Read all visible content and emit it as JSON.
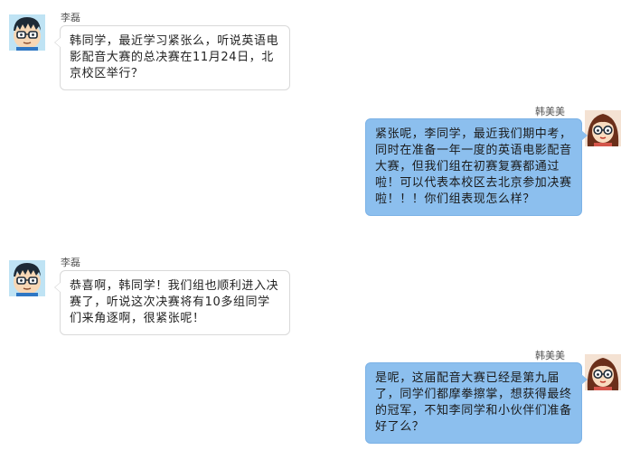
{
  "messages": [
    {
      "sender": "李磊",
      "side": "left",
      "avatar": "boy-with-glasses-avatar",
      "text": "韩同学，最近学习紧张么，听说英语电影配音大赛的总决赛在11月24日，北京校区举行？"
    },
    {
      "sender": "韩美美",
      "side": "right",
      "avatar": "girl-with-glasses-avatar",
      "text": "紧张呢，李同学，最近我们期中考，同时在准备一年一度的英语电影配音大赛，但我们组在初赛复赛都通过啦！可以代表本校区去北京参加决赛啦！！！你们组表现怎么样？"
    },
    {
      "sender": "李磊",
      "side": "left",
      "avatar": "boy-with-glasses-avatar",
      "text": "恭喜啊，韩同学！我们组也顺利进入决赛了，听说这次决赛将有10多组同学们来角逐啊，很紧张呢！"
    },
    {
      "sender": "韩美美",
      "side": "right",
      "avatar": "girl-with-glasses-avatar",
      "text": "是呢，这届配音大赛已经是第九届了，同学们都摩拳擦掌，想获得最终的冠军，不知李同学和小伙伴们准备好了么？"
    }
  ]
}
